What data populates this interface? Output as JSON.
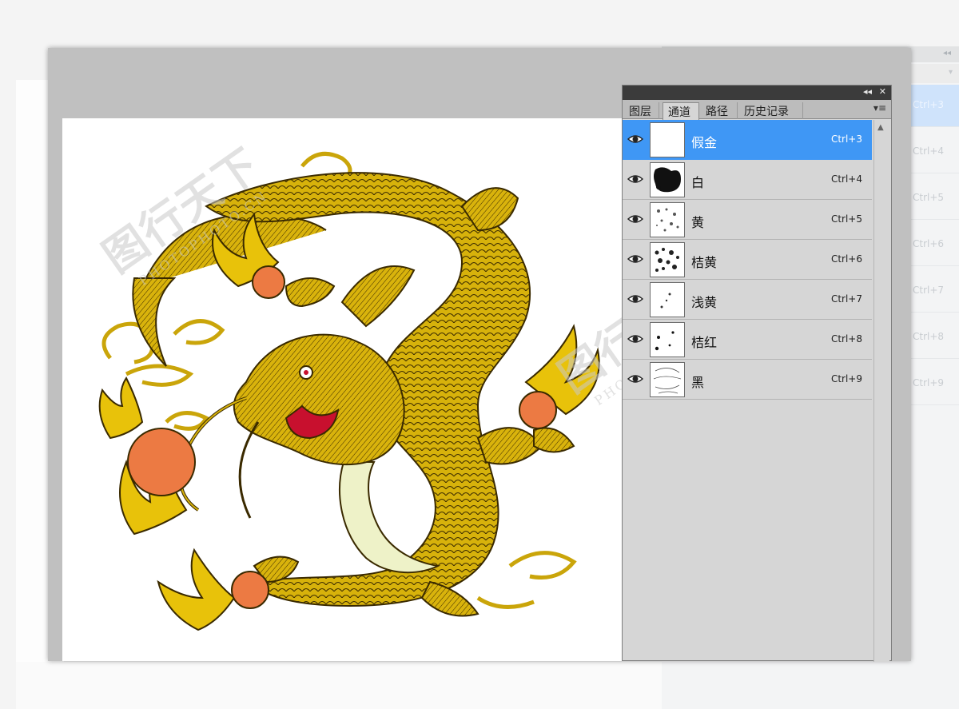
{
  "background_panel": {
    "collapse_icon": "double-chevron-icon",
    "shortcuts": [
      "Ctrl+3",
      "Ctrl+4",
      "Ctrl+5",
      "Ctrl+6",
      "Ctrl+7",
      "Ctrl+8",
      "Ctrl+9"
    ]
  },
  "panel": {
    "collapse_glyph": "◂◂",
    "close_glyph": "✕",
    "menu_glyph": "▾≡",
    "tabs": [
      {
        "label": "图层",
        "active": false
      },
      {
        "label": "通道",
        "active": true
      },
      {
        "label": "路径",
        "active": false
      },
      {
        "label": "历史记录",
        "active": false
      }
    ],
    "channels": [
      {
        "name": "假金",
        "shortcut": "Ctrl+3",
        "selected": true,
        "visible": true,
        "thumb": "blank"
      },
      {
        "name": "白",
        "shortcut": "Ctrl+4",
        "selected": false,
        "visible": true,
        "thumb": "dark"
      },
      {
        "name": "黄",
        "shortcut": "Ctrl+5",
        "selected": false,
        "visible": true,
        "thumb": "light"
      },
      {
        "name": "桔黄",
        "shortcut": "Ctrl+6",
        "selected": false,
        "visible": true,
        "thumb": "medium"
      },
      {
        "name": "浅黄",
        "shortcut": "Ctrl+7",
        "selected": false,
        "visible": true,
        "thumb": "sparse"
      },
      {
        "name": "桔红",
        "shortcut": "Ctrl+8",
        "selected": false,
        "visible": true,
        "thumb": "dots"
      },
      {
        "name": "黑",
        "shortcut": "Ctrl+9",
        "selected": false,
        "visible": true,
        "thumb": "outline"
      }
    ]
  },
  "watermark": {
    "title": "图行天下",
    "subtitle": "PHOTOPHOTO.CN"
  },
  "colors": {
    "dragon_gold": "#d7b20b",
    "dragon_line": "#3a2a00",
    "pearl_orange": "#ec7a43",
    "selection_blue": "#3f97f5",
    "panel_gray": "#d6d6d6"
  }
}
